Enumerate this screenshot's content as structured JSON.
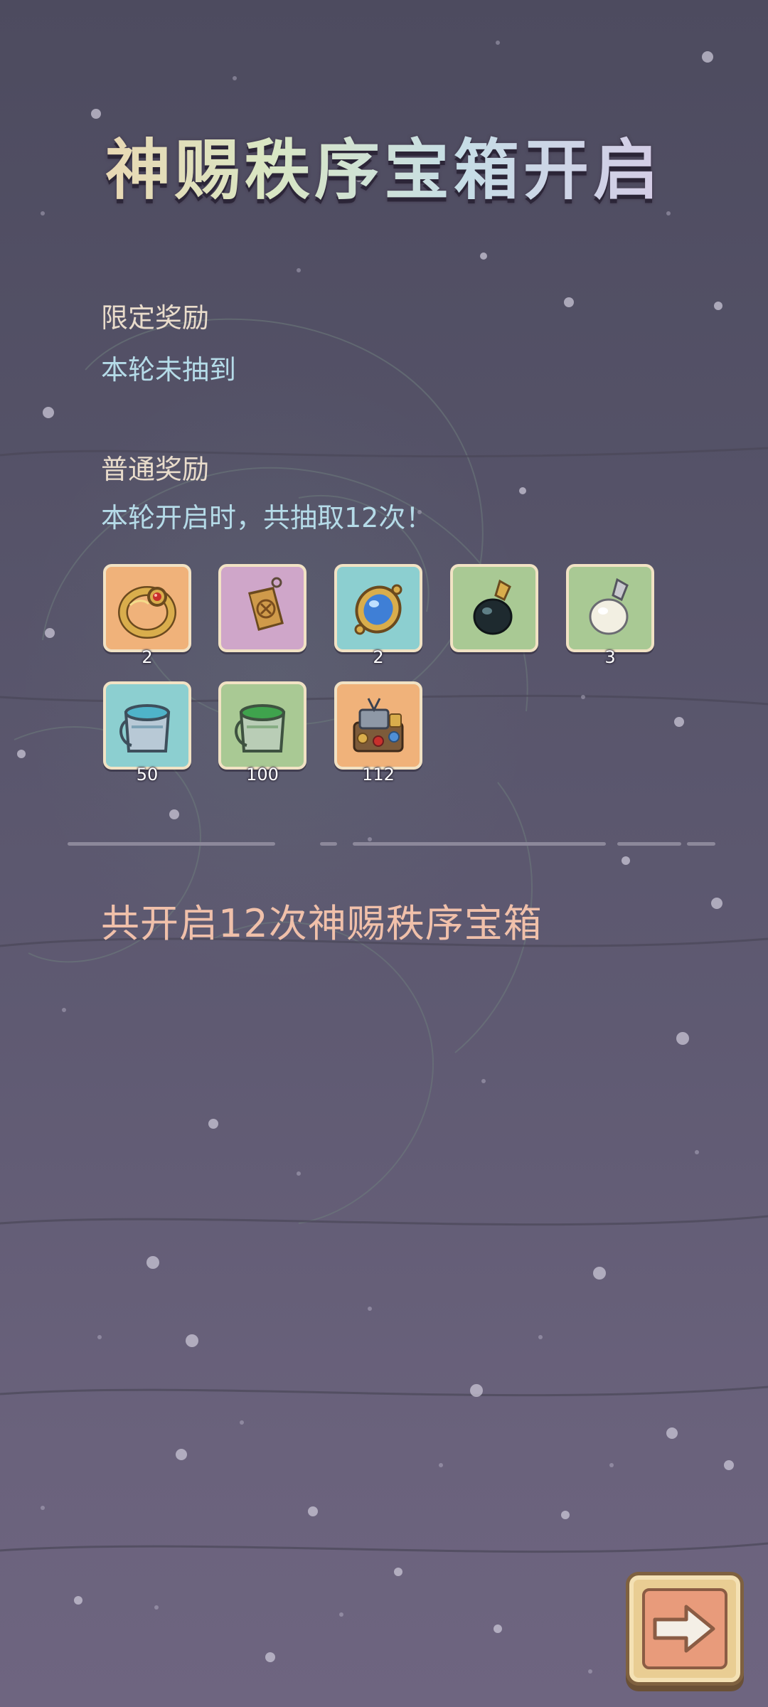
{
  "title": "神赐秩序宝箱开启",
  "limited": {
    "heading": "限定奖励",
    "text": "本轮未抽到"
  },
  "normal": {
    "heading": "普通奖励",
    "text": "本轮开启时，共抽取12次！"
  },
  "rewards": [
    {
      "icon": "ruby-ring-icon",
      "count": "2",
      "bg": "#f0b27a"
    },
    {
      "icon": "amulet-tag-icon",
      "count": "",
      "bg": "#cfa6c9"
    },
    {
      "icon": "sapphire-brooch-icon",
      "count": "2",
      "bg": "#8ccfd0"
    },
    {
      "icon": "black-pearl-pendant-icon",
      "count": "",
      "bg": "#a9c994"
    },
    {
      "icon": "white-pearl-pendant-icon",
      "count": "3",
      "bg": "#a9c994"
    },
    {
      "icon": "blue-paint-bucket-icon",
      "count": "50",
      "bg": "#8ccfd0"
    },
    {
      "icon": "green-paint-bucket-icon",
      "count": "100",
      "bg": "#a9c994"
    },
    {
      "icon": "treasure-pile-icon",
      "count": "112",
      "bg": "#f0b27a"
    }
  ],
  "summary": "共开启12次神赐秩序宝箱",
  "next_button": {
    "icon": "arrow-right-icon"
  }
}
